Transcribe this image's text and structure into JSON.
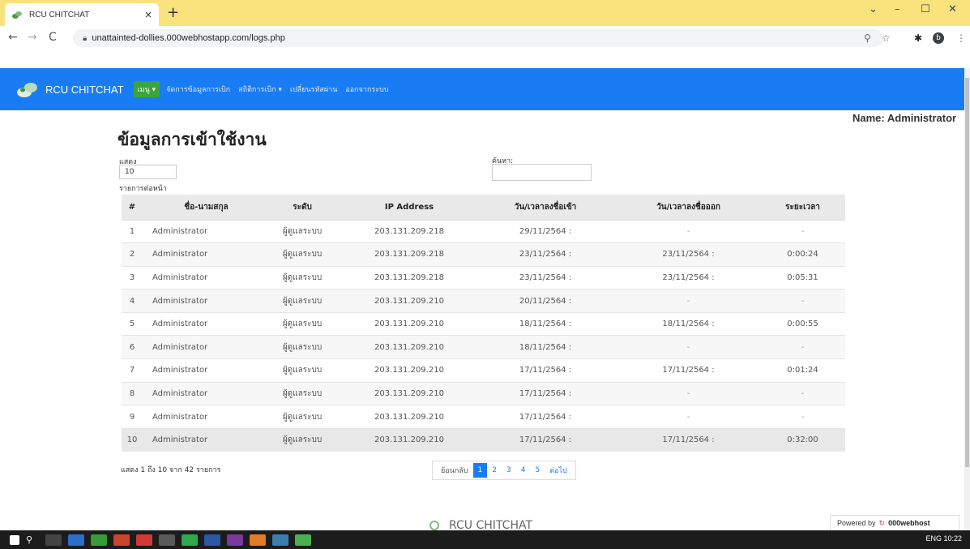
{
  "browser": {
    "tab_title": "RCU CHITCHAT",
    "tab_close": "×",
    "new_tab": "+",
    "url": "unattainted-dollies.000webhostapp.com/logs.php",
    "win_min": "–",
    "win_max": "☐",
    "win_close": "✕",
    "win_chevron": "⌄",
    "profile_letter": "b"
  },
  "nav": {
    "brand": "RCU CHITCHAT",
    "menu": "เมนู ▾",
    "links": [
      "จัดการข้อมูลการเบิก",
      "สถิติการเบิก ▾",
      "เปลี่ยนรหัสผ่าน",
      "ออกจากระบบ"
    ]
  },
  "user": {
    "name_label": "Name: Administrator"
  },
  "page": {
    "title": "ข้อมูลการเข้าใช้งาน",
    "length_label": "แสดง",
    "length_value": "10",
    "length_suffix": "รายการต่อหน้า",
    "search_label": "ค้นหา:"
  },
  "table": {
    "headers": [
      "#",
      "ชื่อ-นามสกุล",
      "ระดับ",
      "IP Address",
      "วัน/เวลาลงชื่อเข้า",
      "วัน/เวลาลงชื่อออก",
      "ระยะเวลา"
    ],
    "rows": [
      {
        "num": "1",
        "name": "Administrator",
        "level": "ผู้ดูแลระบบ",
        "ip": "203.131.209.218",
        "in": "29/11/2564 :",
        "out": "-",
        "dur": "-"
      },
      {
        "num": "2",
        "name": "Administrator",
        "level": "ผู้ดูแลระบบ",
        "ip": "203.131.209.218",
        "in": "23/11/2564 :",
        "out": "23/11/2564 :",
        "dur": "0:00:24"
      },
      {
        "num": "3",
        "name": "Administrator",
        "level": "ผู้ดูแลระบบ",
        "ip": "203.131.209.218",
        "in": "23/11/2564 :",
        "out": "23/11/2564 :",
        "dur": "0:05:31"
      },
      {
        "num": "4",
        "name": "Administrator",
        "level": "ผู้ดูแลระบบ",
        "ip": "203.131.209.210",
        "in": "20/11/2564 :",
        "out": "-",
        "dur": "-"
      },
      {
        "num": "5",
        "name": "Administrator",
        "level": "ผู้ดูแลระบบ",
        "ip": "203.131.209.210",
        "in": "18/11/2564 :",
        "out": "18/11/2564 :",
        "dur": "0:00:55"
      },
      {
        "num": "6",
        "name": "Administrator",
        "level": "ผู้ดูแลระบบ",
        "ip": "203.131.209.210",
        "in": "18/11/2564 :",
        "out": "-",
        "dur": "-"
      },
      {
        "num": "7",
        "name": "Administrator",
        "level": "ผู้ดูแลระบบ",
        "ip": "203.131.209.210",
        "in": "17/11/2564 :",
        "out": "17/11/2564 :",
        "dur": "0:01:24"
      },
      {
        "num": "8",
        "name": "Administrator",
        "level": "ผู้ดูแลระบบ",
        "ip": "203.131.209.210",
        "in": "17/11/2564 :",
        "out": "-",
        "dur": "-"
      },
      {
        "num": "9",
        "name": "Administrator",
        "level": "ผู้ดูแลระบบ",
        "ip": "203.131.209.210",
        "in": "17/11/2564 :",
        "out": "-",
        "dur": "-"
      },
      {
        "num": "10",
        "name": "Administrator",
        "level": "ผู้ดูแลระบบ",
        "ip": "203.131.209.210",
        "in": "17/11/2564 :",
        "out": "17/11/2564 :",
        "dur": "0:32:00"
      }
    ]
  },
  "footer": {
    "info": "แสดง 1 ถึง 10 จาก 42 รายการ",
    "prev": "ย้อนกลับ",
    "pages": [
      "1",
      "2",
      "3",
      "4",
      "5"
    ],
    "active_page": "1",
    "next": "ต่อไป",
    "brand": "RCU CHITCHAT",
    "powered_by": "Powered by",
    "powered_brand": "000webhost"
  },
  "taskbar": {
    "tray": "ENG  10:22"
  },
  "colors": {
    "navbar": "#1a7cf4",
    "menu_button": "#3aa53a",
    "tabbar": "#fae27c"
  }
}
